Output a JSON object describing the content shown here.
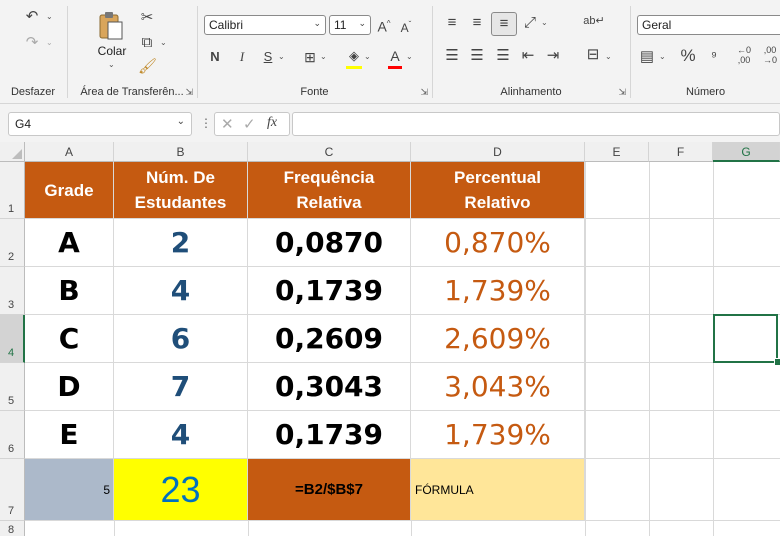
{
  "ribbon": {
    "groups": {
      "undo": "Desfazer",
      "clipboard": "Área de Transferên...",
      "font": "Fonte",
      "alignment": "Alinhamento",
      "number": "Número"
    },
    "paste_label": "Colar",
    "font_name": "Calibri",
    "font_size": "11",
    "number_format": "Geral",
    "bold": "N",
    "italic": "I",
    "underline": "S",
    "percent": "%"
  },
  "formula_bar": {
    "name_box": "G4",
    "fx": "fx",
    "value": ""
  },
  "grid": {
    "columns": [
      "A",
      "B",
      "C",
      "D",
      "E",
      "F",
      "G"
    ],
    "rows": [
      "1",
      "2",
      "3",
      "4",
      "5",
      "6",
      "7",
      "8"
    ],
    "headers": {
      "a": "Grade",
      "b1": "Núm. De",
      "b2": "Estudantes",
      "c1": "Frequência",
      "c2": "Relativa",
      "d1": "Percentual",
      "d2": "Relativo"
    },
    "data_rows": [
      {
        "grade": "A",
        "count": "2",
        "freq": "0,0870",
        "pct": "0,870%"
      },
      {
        "grade": "B",
        "count": "4",
        "freq": "0,1739",
        "pct": "1,739%"
      },
      {
        "grade": "C",
        "count": "6",
        "freq": "0,2609",
        "pct": "2,609%"
      },
      {
        "grade": "D",
        "count": "7",
        "freq": "0,3043",
        "pct": "3,043%"
      },
      {
        "grade": "E",
        "count": "4",
        "freq": "0,1739",
        "pct": "1,739%"
      }
    ],
    "row7": {
      "a": "5",
      "b": "23",
      "c": "=B2/$B$7",
      "d": "FÓRMULA"
    }
  },
  "colors": {
    "header_fill": "#c55a11",
    "count_text": "#1f4e79",
    "pct_text": "#c55a11",
    "total_fill": "#ffff00",
    "total_text": "#0070c0",
    "a7_fill": "#acb9ca",
    "d7_fill": "#ffe699",
    "selection": "#217346"
  }
}
